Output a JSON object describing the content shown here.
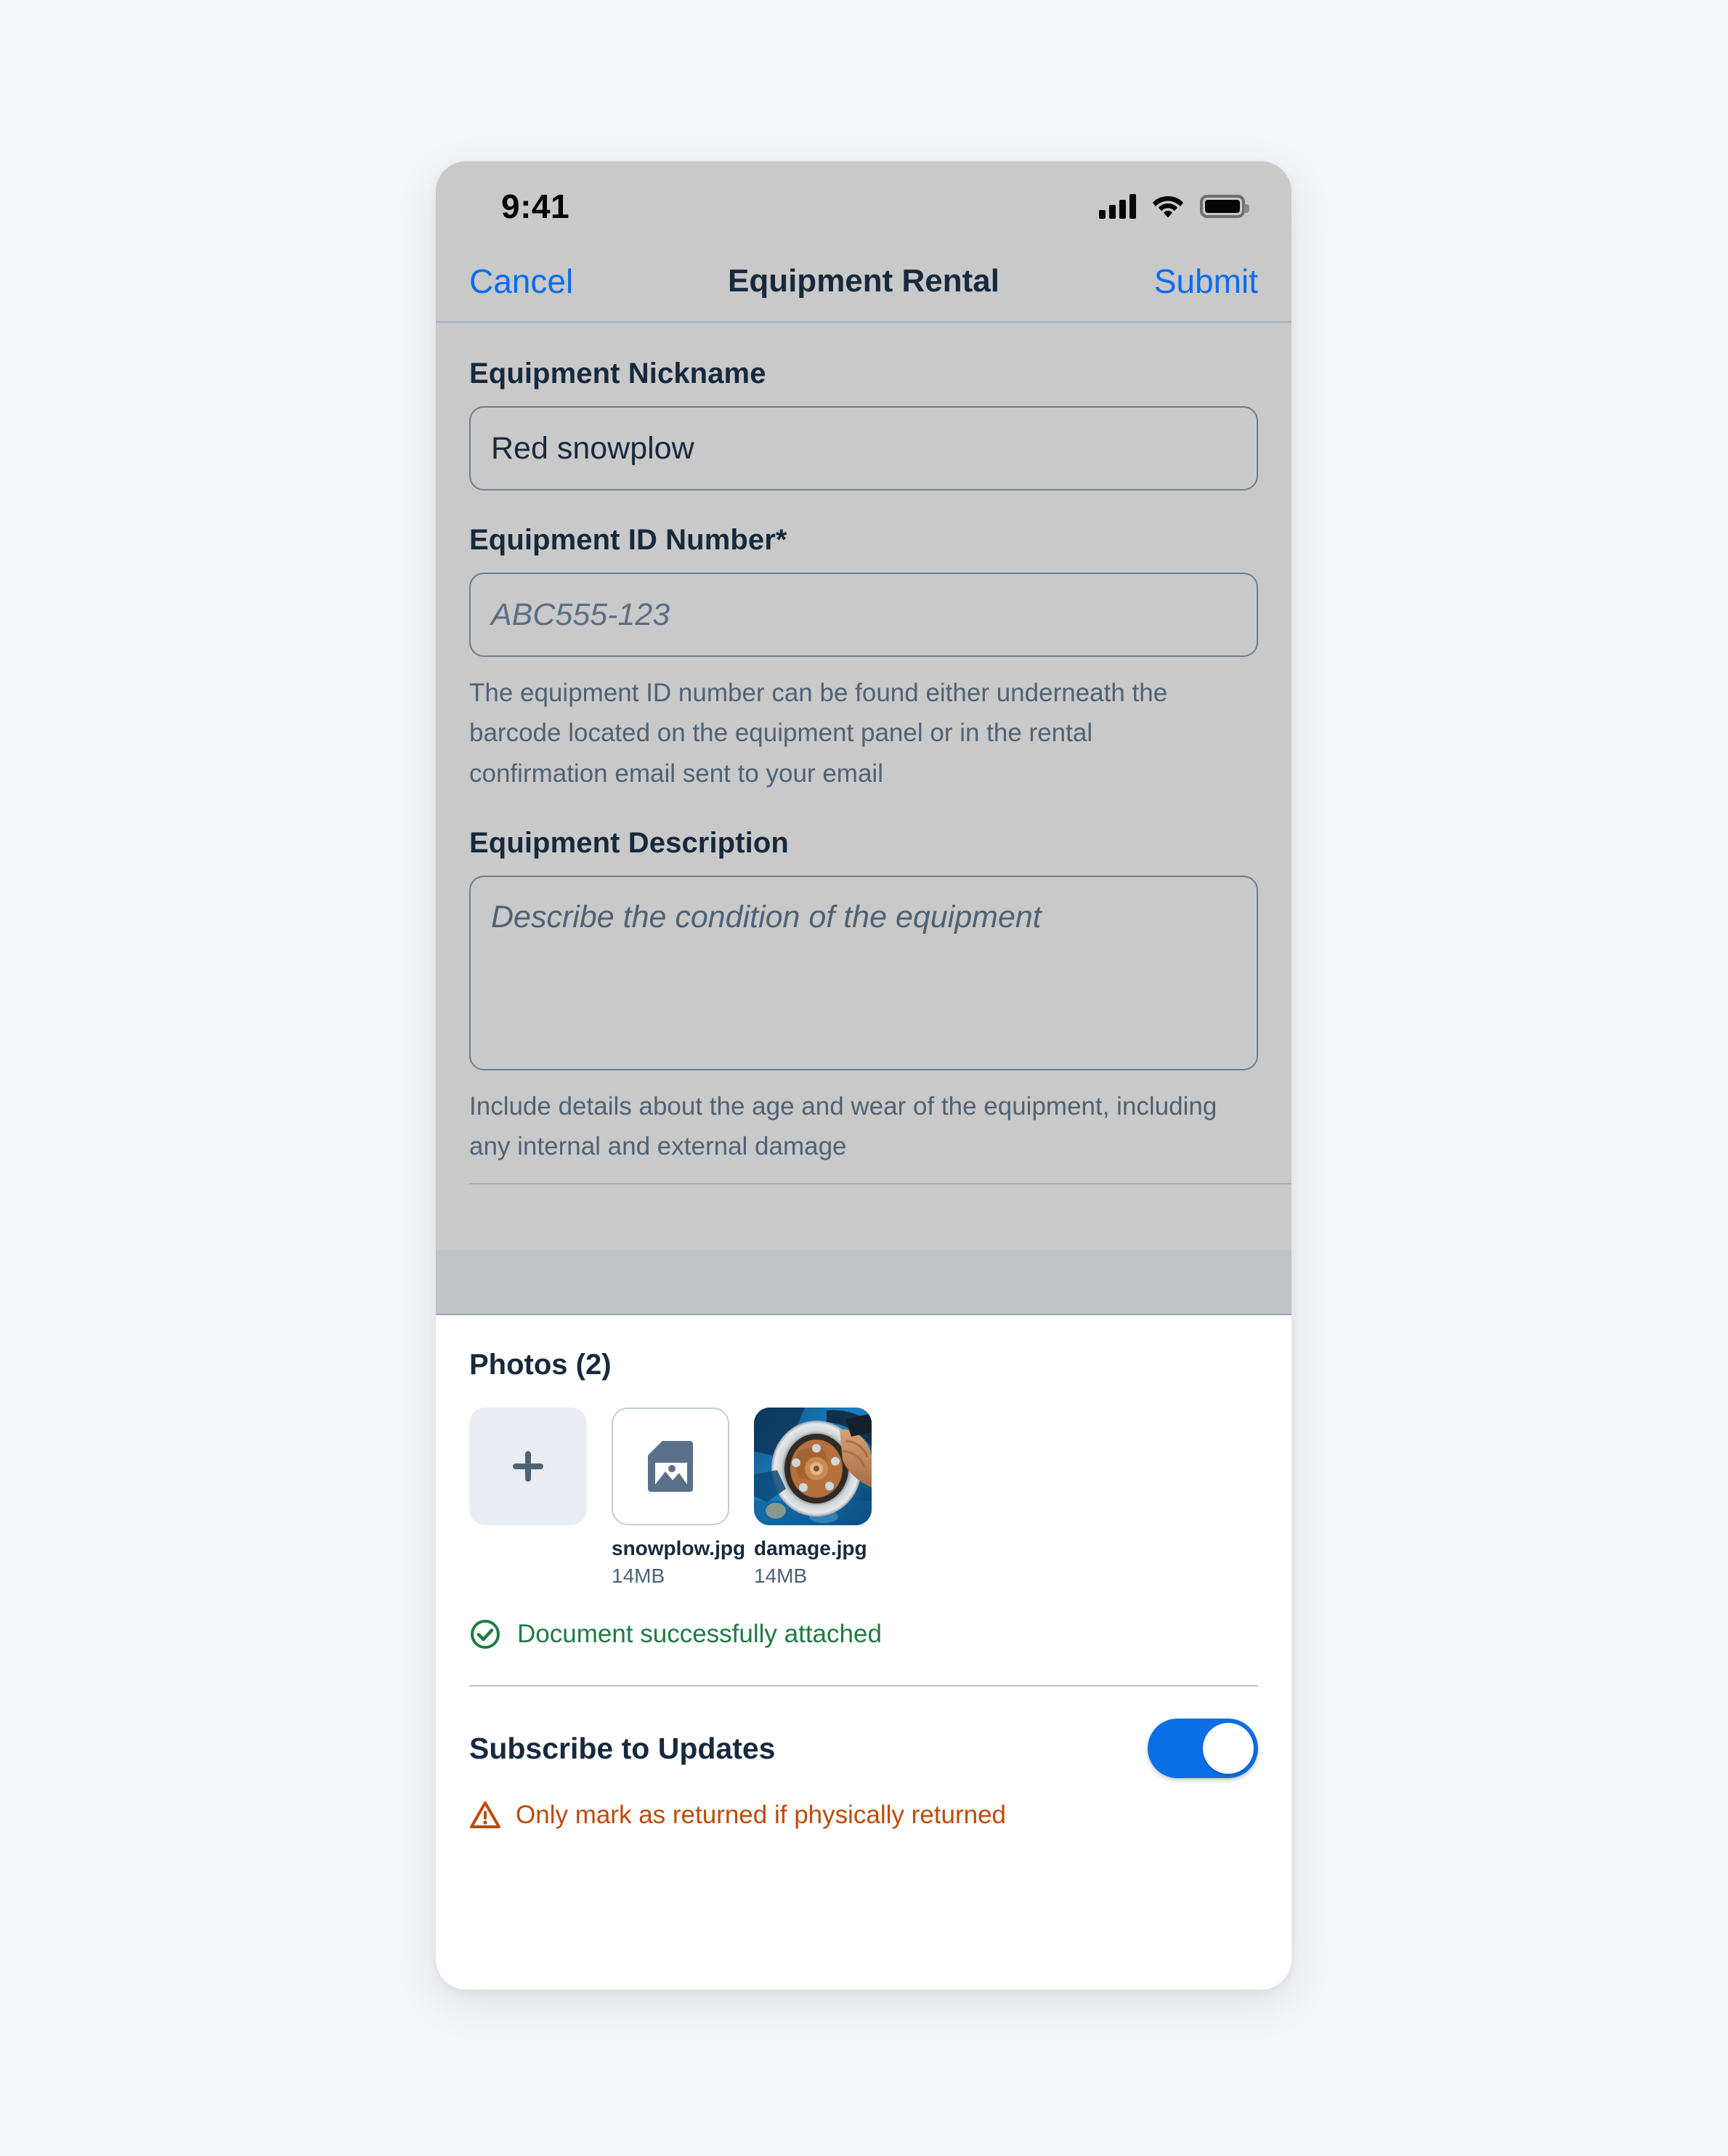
{
  "status_bar": {
    "time": "9:41",
    "icons": [
      "cellular-signal-icon",
      "wifi-icon",
      "battery-icon"
    ]
  },
  "nav": {
    "cancel_label": "Cancel",
    "title": "Equipment Rental",
    "submit_label": "Submit",
    "accent_color": "#0a6cf0"
  },
  "form": {
    "nickname": {
      "label": "Equipment Nickname",
      "value": "Red snowplow",
      "placeholder": ""
    },
    "equipment_id": {
      "label": "Equipment ID Number*",
      "value": "",
      "placeholder": "ABC555-123",
      "helper": "The equipment ID number can be found either underneath the barcode located on the equipment panel or in the rental confirmation email sent to your email"
    },
    "description": {
      "label": "Equipment Description",
      "value": "",
      "placeholder": "Describe the condition of the equipment",
      "helper": "Include details about the age and wear of the equipment, including any internal and external damage"
    }
  },
  "photos": {
    "section_title": "Photos (2)",
    "add_button_glyph": "+",
    "items": [
      {
        "name": "snowplow.jpg",
        "size": "14MB",
        "thumb_type": "file-image-icon"
      },
      {
        "name": "damage.jpg",
        "size": "14MB",
        "thumb_type": "photo-brake-rotor"
      }
    ],
    "status": {
      "icon": "check-circle-icon",
      "text": "Document successfully attached",
      "color": "#1e7b42"
    }
  },
  "subscribe": {
    "label": "Subscribe to Updates",
    "toggle_on": true,
    "toggle_color": "#0b6fe8",
    "warning": {
      "icon": "warning-triangle-icon",
      "text": "Only mark as returned if physically returned",
      "color": "#bf4a09"
    }
  }
}
